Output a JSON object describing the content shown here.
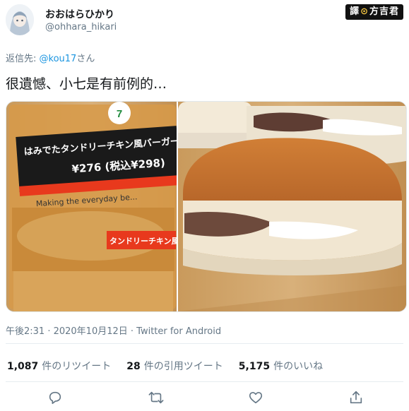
{
  "tweet": {
    "display_name": "おおはらひかり",
    "handle": "@ohhara_hikari",
    "reply_prefix": "返信先: ",
    "reply_mention": "@kou17",
    "reply_suffix": "さん",
    "text": "很遺憾、小七是有前例的…",
    "timestamp": "午後2:31 · 2020年10月12日 · Twitter for Android"
  },
  "watermark": {
    "left": "譯",
    "sep": "⊙",
    "right": "方吉君"
  },
  "media": {
    "package_title": "はみでたタンドリーチキン風バーガー",
    "package_price": "¥276 (税込¥298)",
    "package_slogan": "Making the everyday be...",
    "package_sticker": "タンドリーチキン風",
    "brand_logo": "7"
  },
  "stats": {
    "retweets_count": "1,087",
    "retweets_label": "件のリツイート",
    "quotes_count": "28",
    "quotes_label": "件の引用ツイート",
    "likes_count": "5,175",
    "likes_label": "件のいいね"
  },
  "actions": [
    "reply-icon",
    "retweet-icon",
    "like-icon",
    "share-icon"
  ],
  "colors": {
    "link": "#1b95e0",
    "muted": "#657786",
    "text": "#14171a"
  }
}
